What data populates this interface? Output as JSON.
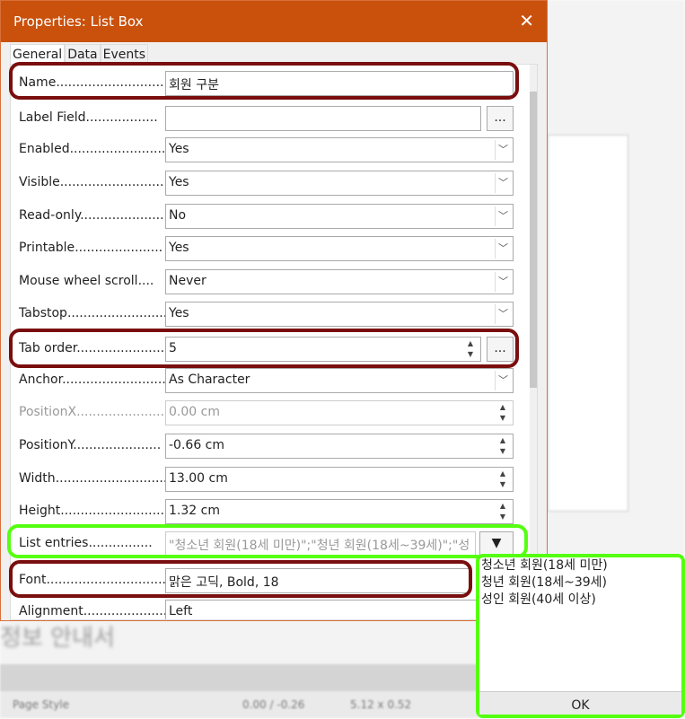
{
  "dialog": {
    "title": "Properties: List Box",
    "close_icon": "close-icon",
    "tabs": [
      "General",
      "Data",
      "Events"
    ],
    "rows": [
      {
        "label": "Name",
        "value": "회원 구분",
        "type": "text"
      },
      {
        "label": "Label Field",
        "value": "",
        "type": "button"
      },
      {
        "label": "Enabled",
        "value": "Yes",
        "type": "select"
      },
      {
        "label": "Visible",
        "value": "Yes",
        "type": "select"
      },
      {
        "label": "Read-only",
        "value": "No",
        "type": "select"
      },
      {
        "label": "Printable",
        "value": "Yes",
        "type": "select"
      },
      {
        "label": "Mouse wheel scroll",
        "value": "Never",
        "type": "select"
      },
      {
        "label": "Tabstop",
        "value": "Yes",
        "type": "select"
      },
      {
        "label": "Tab order",
        "value": "5",
        "type": "spin"
      },
      {
        "label": "Anchor",
        "value": "As Character",
        "type": "select"
      },
      {
        "label": "PositionX",
        "value": "0.00 cm",
        "type": "spin",
        "disabled": true
      },
      {
        "label": "PositionY",
        "value": "-0.66 cm",
        "type": "spin"
      },
      {
        "label": "Width",
        "value": "13.00 cm",
        "type": "spin"
      },
      {
        "label": "Height",
        "value": "1.32 cm",
        "type": "spin"
      },
      {
        "label": "List entries",
        "value": "\"청소년 회원(18세 미만)\";\"청년 회원(18세~39세)\";\"성",
        "type": "listdrop"
      },
      {
        "label": "Font",
        "value": "맑은 고딕, Bold, 18",
        "type": "text"
      },
      {
        "label": "Alignment",
        "value": "Left",
        "type": "text"
      }
    ],
    "dots_label": "..."
  },
  "popup": {
    "items": [
      "청소년 회원(18세 미만)",
      "청년 회원(18세~39세)",
      "성인 회원(40세 이상)"
    ],
    "ok": "OK"
  },
  "background": {
    "title": "정보 안내서",
    "status": [
      "Page Style",
      "0.00 / -0.26",
      "5.12 x 0.52"
    ]
  },
  "colors": {
    "titlebar": "#c9510c",
    "highlight_red": "#7a0e0e",
    "highlight_green": "#55ff11"
  }
}
